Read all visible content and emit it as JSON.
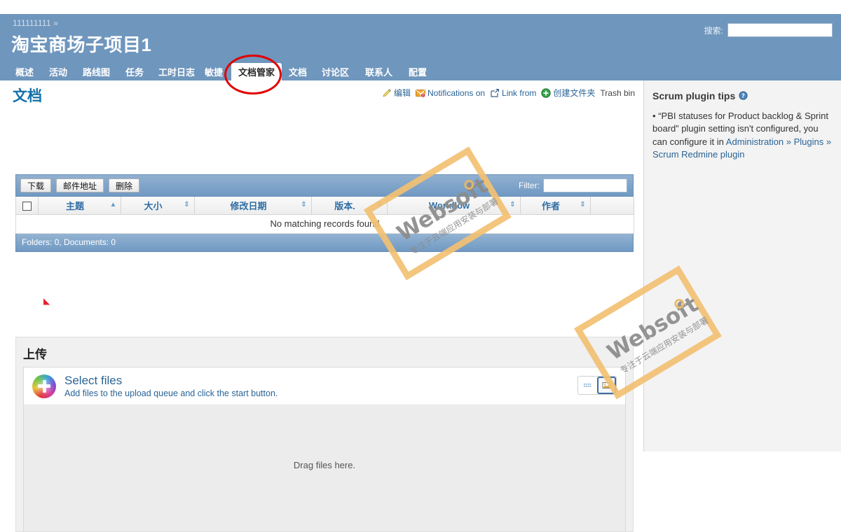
{
  "header": {
    "breadcrumb": "111111111",
    "breadcrumb_separator": "»",
    "project_title": "淘宝商场子项目1",
    "search_label": "搜索:",
    "search_value": "",
    "search_placeholder": ""
  },
  "tabs": [
    {
      "label": "概述",
      "active": false
    },
    {
      "label": "活动",
      "active": false
    },
    {
      "label": "路线图",
      "active": false
    },
    {
      "label": "任务",
      "active": false
    },
    {
      "label": "工时日志",
      "active": false
    },
    {
      "label": "敏捷",
      "active": false
    },
    {
      "label": "文档管家",
      "active": true
    },
    {
      "label": "文档",
      "active": false
    },
    {
      "label": "讨论区",
      "active": false
    },
    {
      "label": "联系人",
      "active": false
    },
    {
      "label": "配置",
      "active": false
    }
  ],
  "main": {
    "page_title": "文档",
    "contextual": [
      {
        "label": "编辑",
        "icon": "pencil-icon",
        "link": true
      },
      {
        "label": "Notifications on",
        "icon": "notification-icon",
        "link": true
      },
      {
        "label": "Link from",
        "icon": "external-link-icon",
        "link": true
      },
      {
        "label": "创建文件夹",
        "icon": "add-circle-icon",
        "link": true
      },
      {
        "label": "Trash bin",
        "icon": "",
        "link": false
      }
    ]
  },
  "documents_table": {
    "toolbar_buttons": [
      "下载",
      "邮件地址",
      "删除"
    ],
    "filter_label": "Filter:",
    "filter_value": "",
    "columns": [
      {
        "label": "",
        "sort": "none"
      },
      {
        "label": "主题",
        "sort": "asc"
      },
      {
        "label": "大小",
        "sort": "both"
      },
      {
        "label": "修改日期",
        "sort": "both"
      },
      {
        "label": "版本.",
        "sort": "both"
      },
      {
        "label": "Workflow",
        "sort": "both"
      },
      {
        "label": "作者",
        "sort": "both"
      },
      {
        "label": "",
        "sort": "none"
      }
    ],
    "empty_message": "No matching records found",
    "footer": "Folders: 0, Documents: 0"
  },
  "upload": {
    "section_title": "上传",
    "select_files_label": "Select files",
    "select_files_sub": "Add files to the upload queue and click the start button.",
    "dropzone_text": "Drag files here.",
    "view_buttons": [
      {
        "icon": "list-view-icon",
        "selected": false
      },
      {
        "icon": "thumbnail-view-icon",
        "selected": true
      }
    ]
  },
  "sidebar": {
    "title": "Scrum plugin tips",
    "title_icon": "help-icon",
    "bullet": "•",
    "body_text": "“PBI statuses for Product backlog & Sprint board” plugin setting isn't configured, you can configure it in ",
    "link_text": "Administration » Plugins » Scrum Redmine plugin"
  },
  "annotation": {
    "type": "red-ellipse-highlight",
    "target": "文档管家",
    "color": "#e00000"
  },
  "watermarks": [
    {
      "text": "Websoft",
      "subtext": "专注于云端应用安装与部署"
    },
    {
      "text": "Websoft",
      "subtext": "专注于云端应用安装与部署"
    }
  ],
  "colors": {
    "header_blue": "#6f96bd",
    "link_blue": "#2a6496",
    "title_blue": "#1270a8",
    "panel_blue": "#7fa4c8",
    "accent_red": "#e00000",
    "watermark_orange": "#f2c173"
  }
}
